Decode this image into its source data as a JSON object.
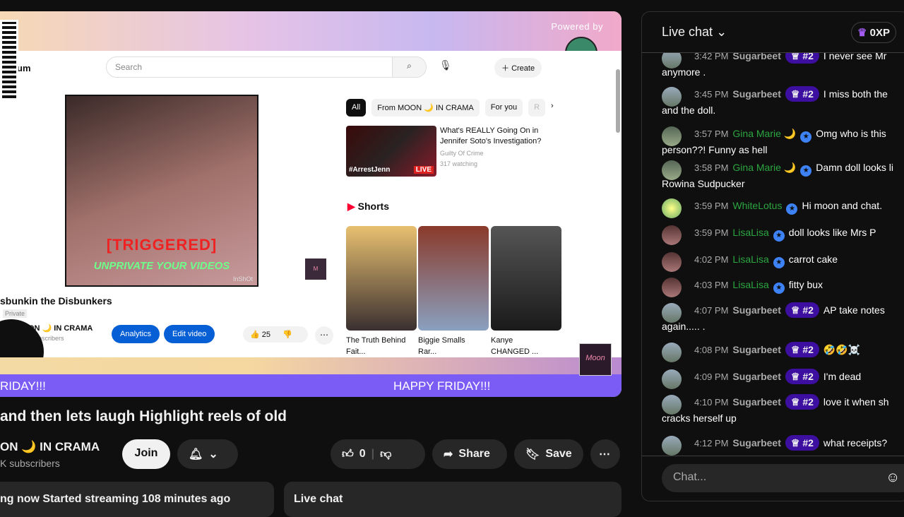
{
  "stream_overlay": {
    "powered_by": "Powered by",
    "banner_text_left": "RIDAY!!!",
    "banner_text_right": "HAPPY FRIDAY!!!",
    "moon_logo": "Moon"
  },
  "captured_page": {
    "logo": "um",
    "search_placeholder": "Search",
    "create_label": "Create",
    "video": {
      "overlay_text_1": "[TRIGGERED]",
      "overlay_text_2": "UNPRIVATE YOUR VIDEOS",
      "watermark": "InShOt",
      "title": "sbunkin the Disbunkers",
      "visibility": "Private",
      "channel": "ON 🌙 IN CRAMA",
      "subscribers": "bscribers",
      "analytics_label": "Analytics",
      "edit_label": "Edit video",
      "likes": "25"
    },
    "chips": [
      "All",
      "From MOON 🌙 IN CRAMA",
      "For you",
      "R"
    ],
    "recommended": {
      "title": "What's REALLY Going On in Jennifer Soto's Investigation?",
      "channel": "Guilty Of Crime",
      "viewers": "317 watching",
      "thumb_text": "#ArrestJenn",
      "live": "LIVE"
    },
    "shorts_label": "Shorts",
    "shorts": [
      {
        "title": "The Truth Behind Fait..."
      },
      {
        "title": "Biggie Smalls Rar..."
      },
      {
        "title": "Kanye CHANGED ..."
      }
    ]
  },
  "video_info": {
    "title": "and then lets laugh Highlight reels of old",
    "channel": "ON 🌙 IN CRAMA",
    "subscribers": "K subscribers",
    "join_label": "Join",
    "likes": "0",
    "share_label": "Share",
    "save_label": "Save",
    "status_card": "ng now  Started streaming 108 minutes ago",
    "live_chat_card": "Live chat"
  },
  "chat": {
    "title": "Live chat",
    "xp": "0XP",
    "input_placeholder": "Chat...",
    "messages": [
      {
        "time": "3:42 PM",
        "author": "Sugarbeet",
        "badge": "#2",
        "text": "I never see Mr",
        "cont": "anymore ."
      },
      {
        "time": "3:45 PM",
        "author": "Sugarbeet",
        "badge": "#2",
        "text": "I miss both the",
        "cont": "and the doll."
      },
      {
        "time": "3:57 PM",
        "author": "Gina Marie 🌙",
        "text": "Omg who is this",
        "cont": "person??! Funny as hell"
      },
      {
        "time": "3:58 PM",
        "author": "Gina Marie 🌙",
        "text": "Damn doll looks li",
        "cont": "Rowina Sudpucker"
      },
      {
        "time": "3:59 PM",
        "author": "WhiteLotus",
        "text": "Hi moon and chat."
      },
      {
        "time": "3:59 PM",
        "author": "LisaLisa",
        "text": "doll looks like Mrs P"
      },
      {
        "time": "4:02 PM",
        "author": "LisaLisa",
        "text": "carrot cake"
      },
      {
        "time": "4:03 PM",
        "author": "LisaLisa",
        "text": "fitty bux"
      },
      {
        "time": "4:07 PM",
        "author": "Sugarbeet",
        "badge": "#2",
        "text": "AP take notes",
        "cont": "again..... ."
      },
      {
        "time": "4:08 PM",
        "author": "Sugarbeet",
        "badge": "#2",
        "text": "🤣🤣☠️"
      },
      {
        "time": "4:09 PM",
        "author": "Sugarbeet",
        "badge": "#2",
        "text": "I'm dead"
      },
      {
        "time": "4:10 PM",
        "author": "Sugarbeet",
        "badge": "#2",
        "text": "love it when sh",
        "cont": "cracks herself up"
      },
      {
        "time": "4:12 PM",
        "author": "Sugarbeet",
        "badge": "#2",
        "text": "what receipts?"
      }
    ]
  }
}
